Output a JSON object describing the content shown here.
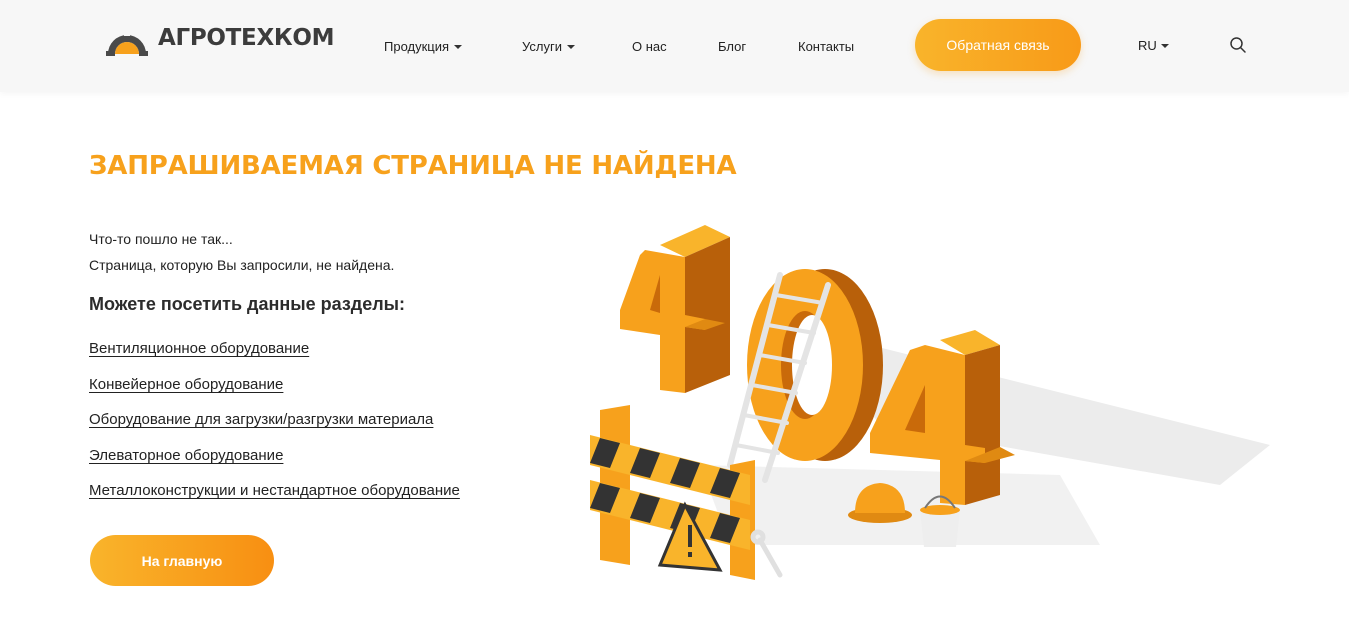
{
  "header": {
    "logo_text": "АГРОТЕХКОМ",
    "nav": [
      {
        "label": "Продукция",
        "has_dropdown": true
      },
      {
        "label": "Услуги",
        "has_dropdown": true
      },
      {
        "label": "О нас",
        "has_dropdown": false
      },
      {
        "label": "Блог",
        "has_dropdown": false
      },
      {
        "label": "Контакты",
        "has_dropdown": false
      }
    ],
    "cta_label": "Обратная связь",
    "lang": "RU",
    "search_icon": "search-icon"
  },
  "main": {
    "title": "ЗАПРАШИВАЕМАЯ СТРАНИЦА НЕ НАЙДЕНА",
    "message_line1": "Что-то пошло не так...",
    "message_line2": "Страница, которую Вы запросили, не найдена.",
    "subheading": "Можете посетить данные разделы:",
    "links": [
      "Вентиляционное оборудование",
      "Конвейерное оборудование",
      "Оборудование для загрузки/разгрузки материала",
      "Элеваторное оборудование",
      "Металлоконструкции и нестандартное оборудование"
    ],
    "home_button": "На главную"
  },
  "colors": {
    "accent": "#f7a11c",
    "accent_dark": "#f88f12",
    "header_bg": "#f7f7f7",
    "text": "#222222"
  }
}
